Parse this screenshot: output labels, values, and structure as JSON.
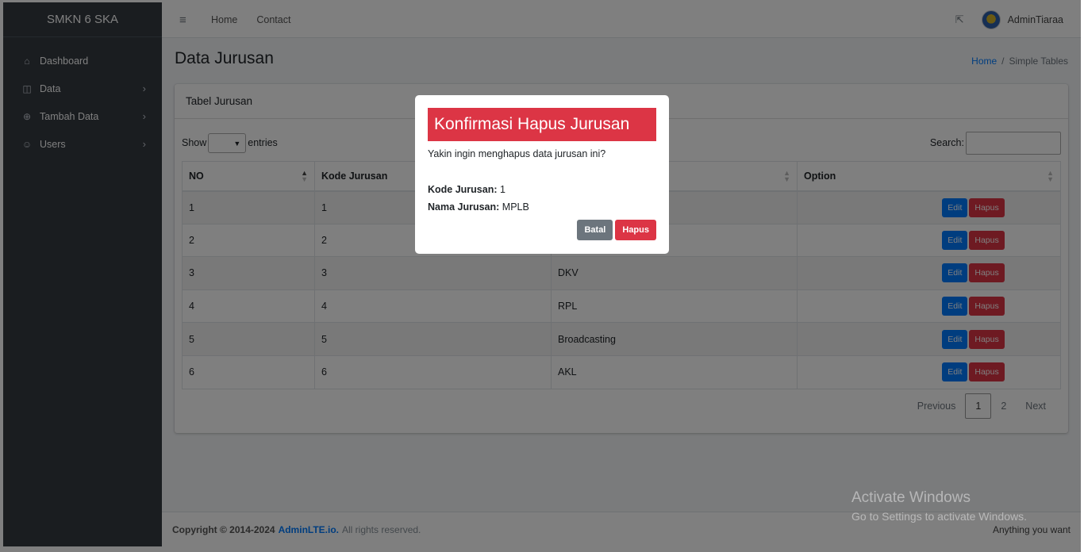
{
  "sidebar": {
    "brand": "SMKN 6 SKA",
    "items": [
      {
        "label": "Dashboard",
        "icon": "home-icon"
      },
      {
        "label": "Data",
        "icon": "chart-icon"
      },
      {
        "label": "Tambah Data",
        "icon": "plus-circle-icon"
      },
      {
        "label": "Users",
        "icon": "users-icon"
      }
    ]
  },
  "navbar": {
    "links": [
      "Home",
      "Contact"
    ],
    "username": "AdminTiaraa"
  },
  "page": {
    "title": "Data Jurusan",
    "breadcrumb": {
      "home": "Home",
      "current": "Simple Tables"
    }
  },
  "card": {
    "title": "Tabel Jurusan",
    "show_label": "Show",
    "entries_label": "entries",
    "search_label": "Search:"
  },
  "table": {
    "headers": [
      "NO",
      "Kode Jurusan",
      "",
      "Option"
    ],
    "rows": [
      {
        "no": "1",
        "kode": "1",
        "nama": ""
      },
      {
        "no": "2",
        "kode": "2",
        "nama": ""
      },
      {
        "no": "3",
        "kode": "3",
        "nama": "DKV"
      },
      {
        "no": "4",
        "kode": "4",
        "nama": "RPL"
      },
      {
        "no": "5",
        "kode": "5",
        "nama": "Broadcasting"
      },
      {
        "no": "6",
        "kode": "6",
        "nama": "AKL"
      }
    ],
    "edit_label": "Edit",
    "delete_label": "Hapus"
  },
  "pagination": {
    "previous": "Previous",
    "pages": [
      "1",
      "2"
    ],
    "next": "Next",
    "current": "1"
  },
  "footer": {
    "copyright": "Copyright © 2014-2024",
    "link": "AdminLTE.io.",
    "rights": "All rights reserved.",
    "right_text": "Anything you want"
  },
  "modal": {
    "title": "Konfirmasi Hapus Jurusan",
    "message": "Yakin ingin menghapus data jurusan ini?",
    "kode_label": "Kode Jurusan:",
    "kode_value": "1",
    "nama_label": "Nama Jurusan:",
    "nama_value": "MPLB",
    "cancel_label": "Batal",
    "confirm_label": "Hapus"
  },
  "watermark": {
    "title": "Activate Windows",
    "subtitle": "Go to Settings to activate Windows."
  },
  "colors": {
    "sidebar": "#343a40",
    "primary": "#007bff",
    "danger": "#dc3545",
    "secondary": "#6c757d"
  }
}
